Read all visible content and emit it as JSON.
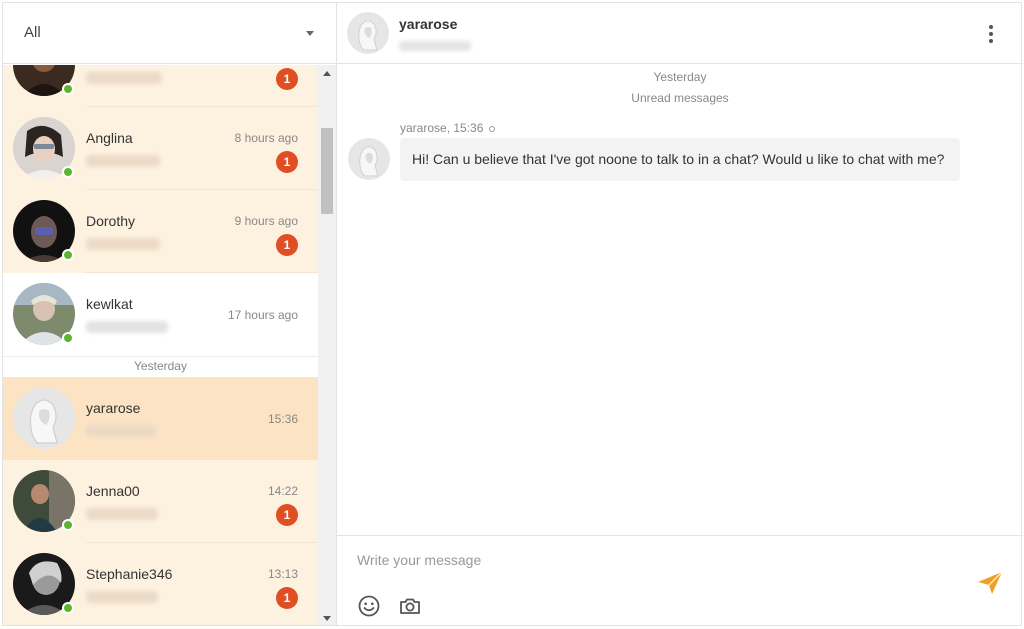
{
  "filter": {
    "selected": "All"
  },
  "conversations": [
    {
      "name": "",
      "time": "",
      "unread": "1",
      "state": "unread"
    },
    {
      "name": "Anglina",
      "time": "8 hours ago",
      "unread": "1",
      "state": "unread"
    },
    {
      "name": "Dorothy",
      "time": "9 hours ago",
      "unread": "1",
      "state": "unread"
    },
    {
      "name": "kewlkat",
      "time": "17 hours ago",
      "unread": "",
      "state": "read"
    },
    {
      "name": "yararose",
      "time": "15:36",
      "unread": "",
      "state": "selected"
    },
    {
      "name": "Jenna00",
      "time": "14:22",
      "unread": "1",
      "state": "unread"
    },
    {
      "name": "Stephanie346",
      "time": "13:13",
      "unread": "1",
      "state": "unread"
    }
  ],
  "list_separator": "Yesterday",
  "chat": {
    "name": "yararose",
    "day_label": "Yesterday",
    "unread_label": "Unread messages",
    "message_meta": "yararose, 15:36",
    "message_text": "Hi! Can u believe that I've got noone to talk to in a chat? Would u like to chat with me?"
  },
  "composer": {
    "placeholder": "Write your message"
  },
  "colors": {
    "accent": "#f0a024",
    "badge": "#e04e24",
    "online": "#5cb531",
    "unread_row": "#fdf1e0",
    "selected_row": "#fce3c4"
  },
  "icons": [
    "chevron-down-icon",
    "kebab-menu-icon",
    "smiley-icon",
    "camera-icon",
    "send-icon"
  ]
}
